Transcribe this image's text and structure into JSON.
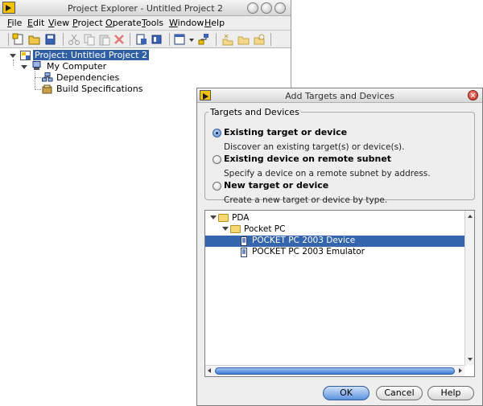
{
  "explorer": {
    "title": "Project Explorer - Untitled Project 2",
    "menu": [
      "File",
      "Edit",
      "View",
      "Project",
      "Operate",
      "Tools",
      "Window",
      "Help"
    ],
    "tree": {
      "project": "Project: Untitled Project 2",
      "computer": "My Computer",
      "dependencies": "Dependencies",
      "build_specs": "Build Specifications"
    }
  },
  "dialog": {
    "title": "Add Targets and Devices",
    "group_label": "Targets and Devices",
    "options": [
      {
        "label": "Existing target or device",
        "desc": "Discover an existing target(s) or device(s).",
        "selected": true
      },
      {
        "label": "Existing device on remote subnet",
        "desc": "Specify a device on a remote subnet by address.",
        "selected": false
      },
      {
        "label": "New target or device",
        "desc": "Create a new target or device by type.",
        "selected": false
      }
    ],
    "list": {
      "root": "PDA",
      "folder": "Pocket PC",
      "items": [
        "POCKET PC 2003 Device",
        "POCKET PC 2003 Emulator"
      ],
      "selected_index": 0
    },
    "buttons": {
      "ok": "OK",
      "cancel": "Cancel",
      "help": "Help"
    }
  },
  "colors": {
    "selection": "#315fa4",
    "dialog_bg": "#eeeeee"
  }
}
